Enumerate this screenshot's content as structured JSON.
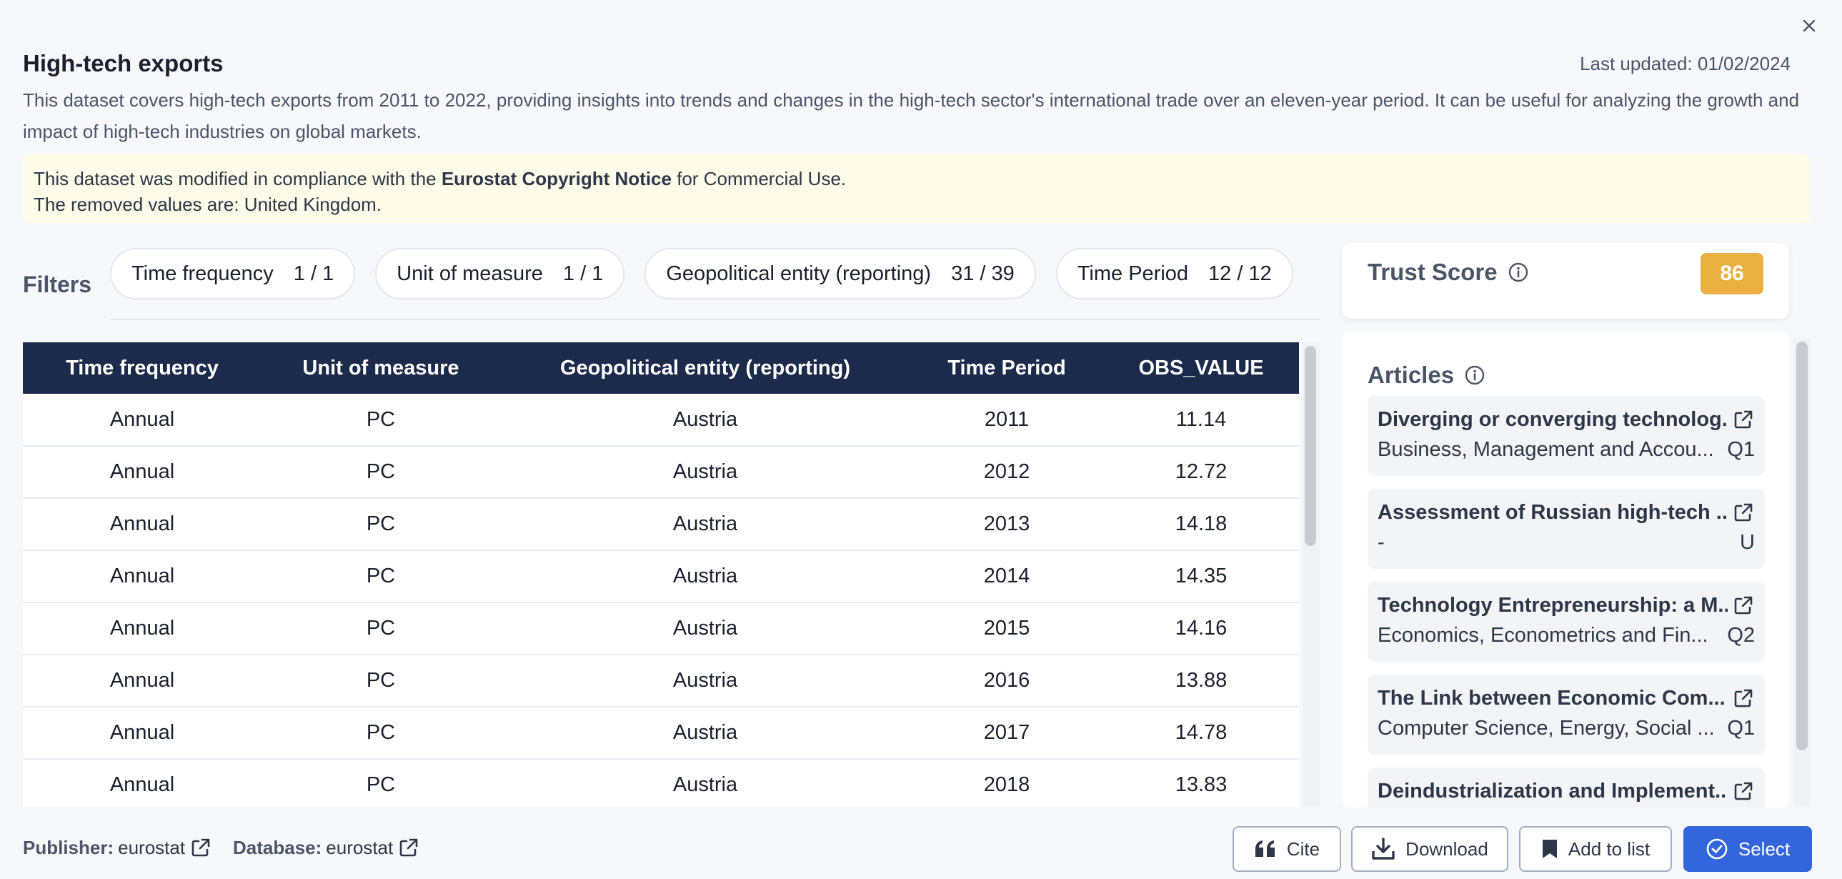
{
  "dialog": {
    "title": "High-tech exports",
    "last_updated": "Last updated: 01/02/2024",
    "description": "This dataset covers high-tech exports from 2011 to 2022, providing insights into trends and changes in the high-tech sector's international trade over an eleven-year period. It can be useful for analyzing the growth and impact of high-tech industries on global markets."
  },
  "notice": {
    "line1_prefix": "This dataset was modified in compliance with the ",
    "line1_bold": "Eurostat Copyright Notice",
    "line1_suffix": " for Commercial Use.",
    "line2": "The removed values are: United Kingdom."
  },
  "filters": {
    "label": "Filters",
    "chips": [
      {
        "label": "Time frequency",
        "count": "1 / 1"
      },
      {
        "label": "Unit of measure",
        "count": "1 / 1"
      },
      {
        "label": "Geopolitical entity (reporting)",
        "count": "31 / 39"
      },
      {
        "label": "Time Period",
        "count": "12 / 12"
      }
    ]
  },
  "table": {
    "headers": [
      "Time frequency",
      "Unit of measure",
      "Geopolitical entity (reporting)",
      "Time Period",
      "OBS_VALUE"
    ],
    "rows": [
      [
        "Annual",
        "PC",
        "Austria",
        "2011",
        "11.14"
      ],
      [
        "Annual",
        "PC",
        "Austria",
        "2012",
        "12.72"
      ],
      [
        "Annual",
        "PC",
        "Austria",
        "2013",
        "14.18"
      ],
      [
        "Annual",
        "PC",
        "Austria",
        "2014",
        "14.35"
      ],
      [
        "Annual",
        "PC",
        "Austria",
        "2015",
        "14.16"
      ],
      [
        "Annual",
        "PC",
        "Austria",
        "2016",
        "13.88"
      ],
      [
        "Annual",
        "PC",
        "Austria",
        "2017",
        "14.78"
      ],
      [
        "Annual",
        "PC",
        "Austria",
        "2018",
        "13.83"
      ]
    ]
  },
  "trust": {
    "label": "Trust Score",
    "score": "86",
    "score_color": "#eab041"
  },
  "articles": {
    "label": "Articles",
    "items": [
      {
        "title": "Diverging or converging technolog...",
        "subject": "Business, Management and Accou...",
        "quartile": "Q1"
      },
      {
        "title": "Assessment of Russian high-tech ...",
        "subject": "-",
        "quartile": "U"
      },
      {
        "title": "Technology Entrepreneurship: a M...",
        "subject": "Economics, Econometrics and Fin...",
        "quartile": "Q2"
      },
      {
        "title": "The Link between Economic Com...",
        "subject": "Computer Science, Energy, Social ...",
        "quartile": "Q1"
      },
      {
        "title": "Deindustrialization and Implement...",
        "subject": "",
        "quartile": ""
      }
    ]
  },
  "footer": {
    "publisher_label": "Publisher:",
    "publisher_value": "eurostat",
    "database_label": "Database:",
    "database_value": "eurostat",
    "cite": "Cite",
    "download": "Download",
    "add_to_list": "Add to list",
    "select": "Select"
  },
  "colors": {
    "table_header": "#1c2a4b",
    "primary": "#3366dd",
    "notice_bg": "#fefbe8"
  },
  "icons": [
    "close-icon",
    "info-icon",
    "external-link-icon",
    "quote-icon",
    "download-icon",
    "bookmark-icon",
    "check-circle-icon"
  ]
}
